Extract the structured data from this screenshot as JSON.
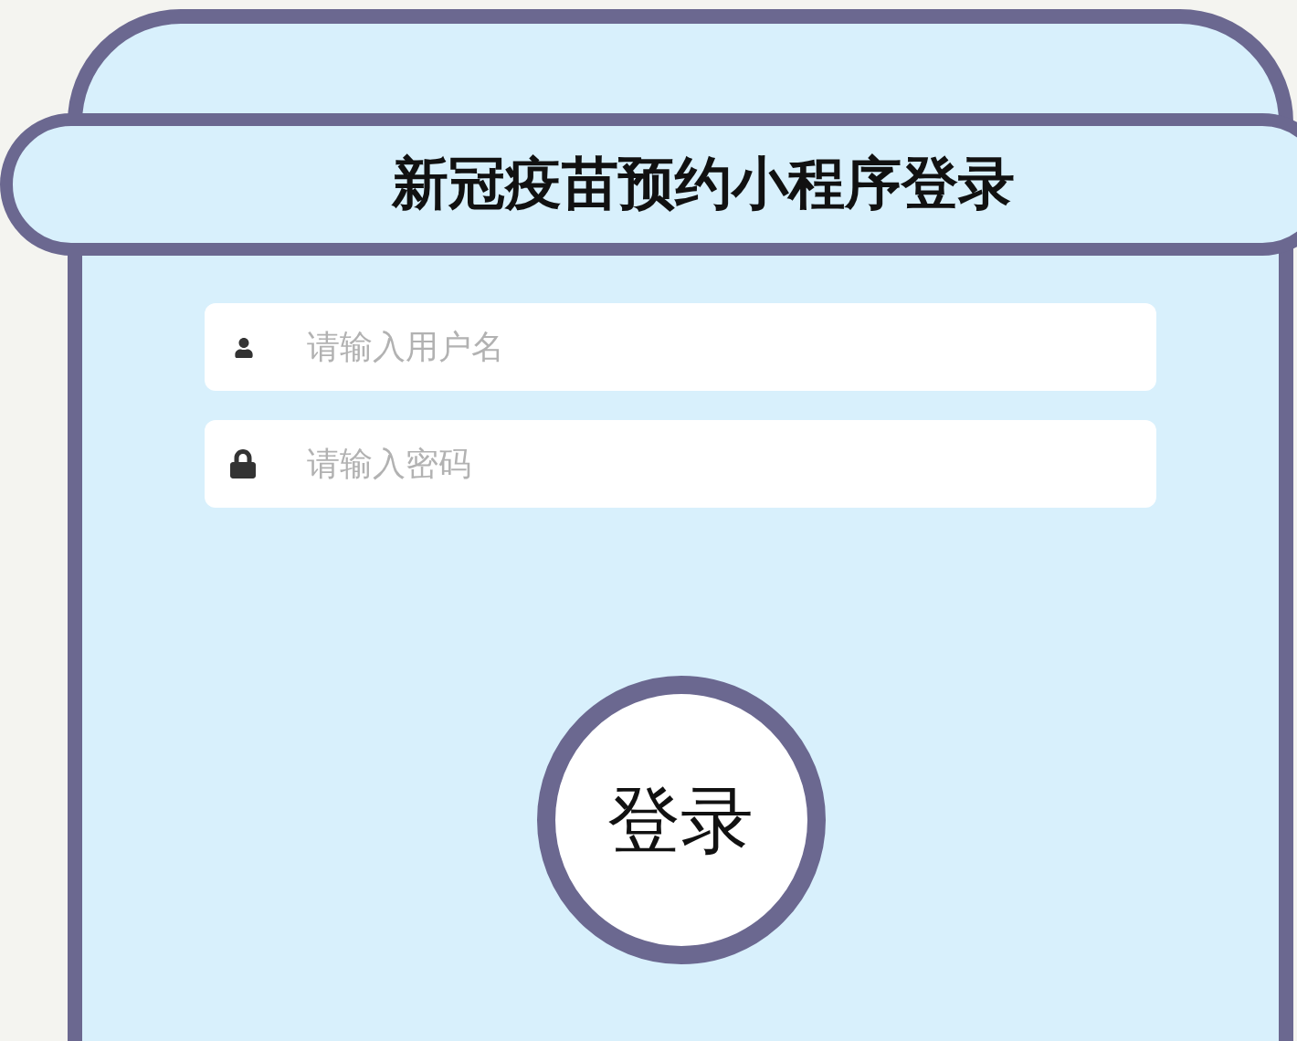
{
  "title": "新冠疫苗预约小程序登录",
  "fields": [
    {
      "kind": "user",
      "placeholder": "请输入用户名"
    },
    {
      "kind": "password",
      "placeholder": "请输入密码"
    }
  ],
  "login_button": "登录"
}
